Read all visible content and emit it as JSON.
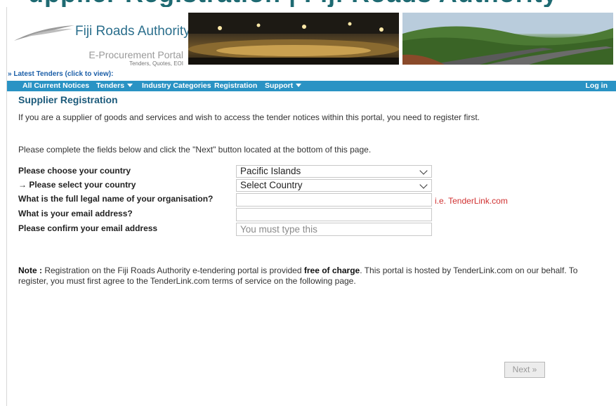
{
  "top_banner": {
    "text": "upplier Registration | Fiji Roads Authority"
  },
  "header": {
    "org_name": "Fiji Roads Authority",
    "portal_name": "E-Procurement Portal",
    "portal_sub": "Tenders, Quotes, EOI"
  },
  "latest_link": "» Latest Tenders (click to view):",
  "nav": {
    "items": [
      {
        "label": "All Current Notices"
      },
      {
        "label": "Tenders"
      },
      {
        "label": "Industry Categories"
      },
      {
        "label": "Registration"
      },
      {
        "label": "Support"
      }
    ],
    "login": "Log in"
  },
  "page": {
    "title": "Supplier Registration",
    "intro": "If you are a supplier of goods and services and wish to access the tender notices within this portal, you need to register first.",
    "instructions": "Please complete the fields below and click the \"Next\" button located at the bottom of this page."
  },
  "form": {
    "country_group_label": "Please choose your country",
    "country_group_value": "Pacific Islands",
    "country_label": "→ Please select your country",
    "country_value": "Select Country",
    "org_label": "What is the full legal name of your organisation?",
    "org_value": "",
    "org_hint": "i.e. TenderLink.com",
    "email_label": "What is your email address?",
    "email_value": "",
    "confirm_label": "Please confirm your email address",
    "confirm_placeholder": "You must type this"
  },
  "note": {
    "prefix": "Note :",
    "part1": " Registration on the Fiji Roads Authority e-tendering portal is provided ",
    "bold": "free of charge",
    "part2": ". This portal is hosted by TenderLink.com on our behalf. To register, you must first agree to the TenderLink.com terms of service on the following page."
  },
  "next_button": "Next »"
}
